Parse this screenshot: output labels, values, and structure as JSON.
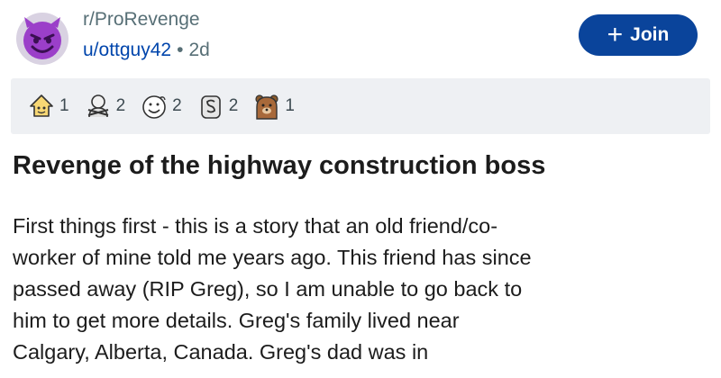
{
  "post": {
    "subreddit": "r/ProRevenge",
    "author": "u/ottguy42",
    "separator": "•",
    "age": "2d",
    "join_label": "Join",
    "join_icon": "+",
    "awards": [
      {
        "icon": "wholesome-award-icon",
        "count": "1"
      },
      {
        "icon": "hugz-award-icon",
        "count": "2"
      },
      {
        "icon": "helpful-award-icon",
        "count": "2"
      },
      {
        "icon": "silver-award-icon",
        "count": "2"
      },
      {
        "icon": "bear-award-icon",
        "count": "1"
      }
    ],
    "title": "Revenge of the highway construction boss",
    "body_lines": [
      "First things first - this is a story that an old friend/co-",
      "worker of mine told me years ago. This friend has since",
      "passed away (RIP Greg), so I am unable to go back to",
      "him to get more details. Greg's family lived near",
      "Calgary, Alberta, Canada. Greg's dad was in"
    ]
  },
  "colors": {
    "join_button": "#0a449b",
    "awards_bar": "#eef0f3",
    "meta_text": "#576f76",
    "author_link": "#0045ac"
  }
}
